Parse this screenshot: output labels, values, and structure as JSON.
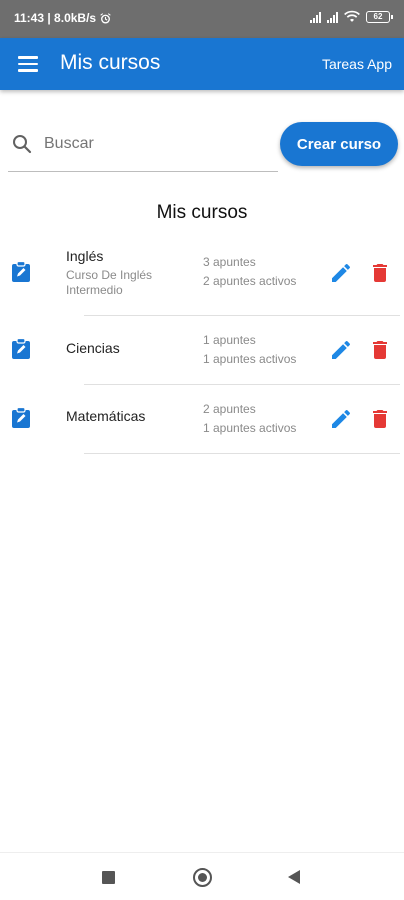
{
  "status_bar": {
    "time_speed": "11:43 | 8.0kB/s",
    "battery": "62"
  },
  "app_bar": {
    "title": "Mis cursos",
    "action_label": "Tareas App"
  },
  "search": {
    "placeholder": "Buscar",
    "value": ""
  },
  "create_button_label": "Crear curso",
  "section_title": "Mis cursos",
  "courses": [
    {
      "name": "Inglés",
      "description": "Curso De Inglés Intermedio",
      "notes": "3 apuntes",
      "active": "2 apuntes activos"
    },
    {
      "name": "Ciencias",
      "description": "",
      "notes": "1 apuntes",
      "active": "1 apuntes activos"
    },
    {
      "name": "Matemáticas",
      "description": "",
      "notes": "2 apuntes",
      "active": "1 apuntes activos"
    }
  ],
  "colors": {
    "primary": "#1976d2",
    "edit_icon": "#1e88e5",
    "delete_icon": "#e53935",
    "status_bar": "#6e6e6e"
  },
  "icons": {
    "menu": "menu-icon",
    "search": "search-icon",
    "course": "assignment-icon",
    "edit": "pencil-icon",
    "delete": "trash-icon"
  }
}
